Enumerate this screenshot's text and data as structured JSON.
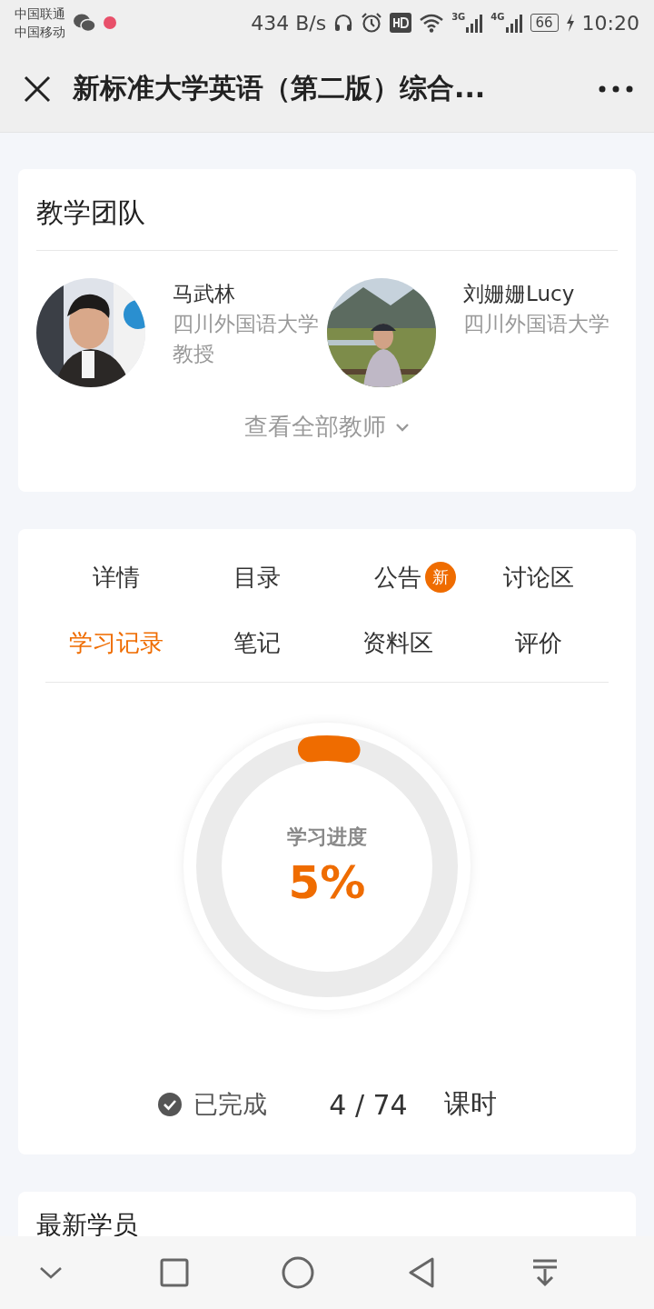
{
  "status_bar": {
    "carriers": [
      "中国联通",
      "中国移动"
    ],
    "speed": "434 B/s",
    "signal_labels": [
      "3G",
      "4G"
    ],
    "battery": "66",
    "time": "10:20"
  },
  "header": {
    "title": "新标准大学英语（第二版）综合..."
  },
  "teaching_team": {
    "title": "教学团队",
    "teachers": [
      {
        "name": "马武林",
        "lines": [
          "四川外国语大学",
          "教授"
        ]
      },
      {
        "name": "刘姗姗Lucy",
        "lines": [
          "四川外国语大学"
        ]
      }
    ],
    "view_all": "查看全部教师"
  },
  "tabs": [
    {
      "label": "详情",
      "selected": false
    },
    {
      "label": "目录",
      "selected": false
    },
    {
      "label": "公告",
      "selected": false,
      "badge": "新"
    },
    {
      "label": "讨论区",
      "selected": false
    },
    {
      "label": "学习记录",
      "selected": true
    },
    {
      "label": "笔记",
      "selected": false
    },
    {
      "label": "资料区",
      "selected": false
    },
    {
      "label": "评价",
      "selected": false
    }
  ],
  "progress": {
    "label": "学习进度",
    "percent": "5%",
    "level": 0.05,
    "completed_label": "已完成",
    "count": "4 / 74",
    "unit": "课时"
  },
  "next_section": {
    "title": "最新学员"
  }
}
